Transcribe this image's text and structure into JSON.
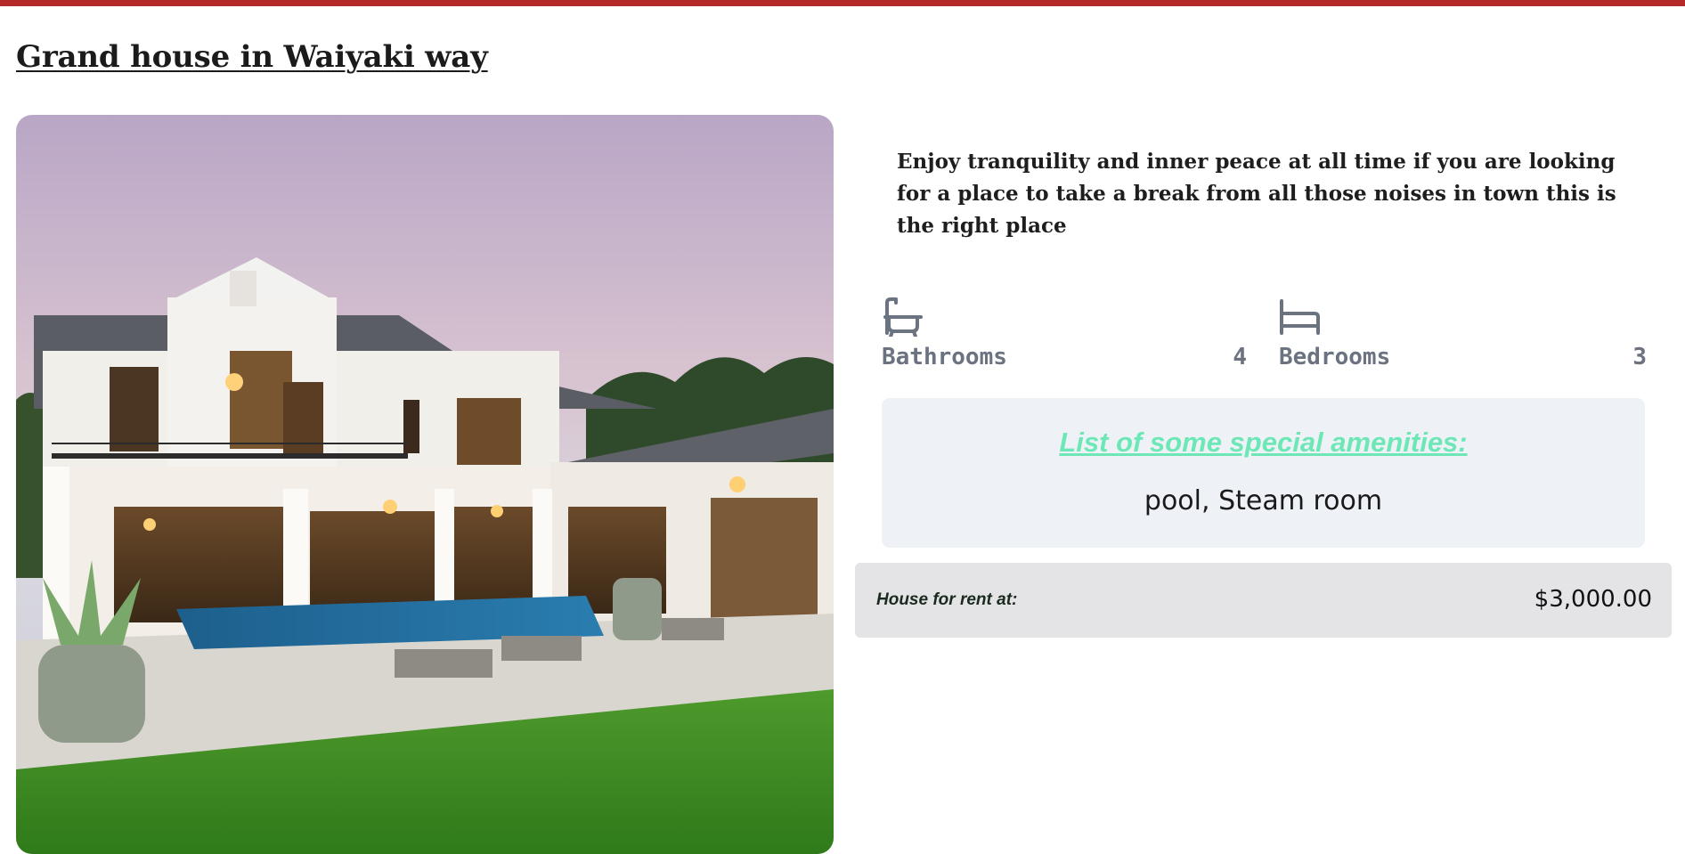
{
  "listing": {
    "title": "Grand house in Waiyaki way",
    "image_alt": "Modern two-storey white house with pool and lawn at dusk",
    "description": "Enjoy tranquility and inner peace at all time if you are looking for a place to take a break from all those noises in town this is the right place"
  },
  "features": {
    "bathrooms": {
      "label": "Bathrooms",
      "count": "4",
      "icon": "bathtub-icon"
    },
    "bedrooms": {
      "label": "Bedrooms",
      "count": "3",
      "icon": "bed-icon"
    }
  },
  "amenities": {
    "heading": "List of some special amenities:",
    "list": "pool, Steam room"
  },
  "price": {
    "label": "House for rent at:",
    "value": "$3,000.00"
  },
  "colors": {
    "top_bar": "#b42a2a",
    "amenities_heading": "#6ee7b7",
    "feature_text": "#6b7280",
    "amenities_bg": "#eef2f7",
    "price_bg": "#e4e4e7"
  }
}
